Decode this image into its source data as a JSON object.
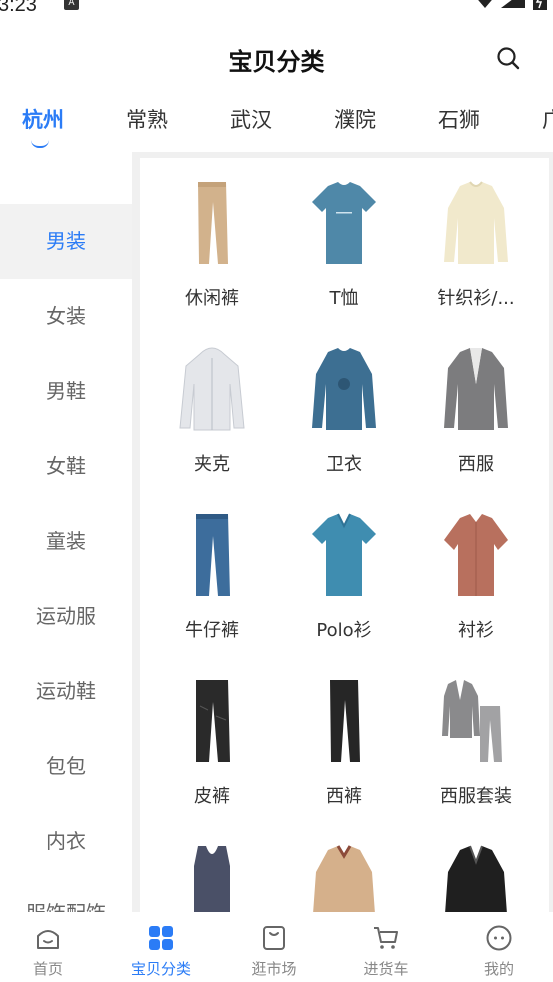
{
  "status_bar": {
    "time": "3:23",
    "notif_icon": "a-icon"
  },
  "header": {
    "title": "宝贝分类",
    "search_icon": "search-icon"
  },
  "city_tabs": [
    {
      "label": "杭州",
      "active": true
    },
    {
      "label": "常熟",
      "active": false
    },
    {
      "label": "武汉",
      "active": false
    },
    {
      "label": "濮院",
      "active": false
    },
    {
      "label": "石狮",
      "active": false
    },
    {
      "label": "广",
      "active": false
    }
  ],
  "sidebar": {
    "items": [
      {
        "label": "男装",
        "active": true
      },
      {
        "label": "女装",
        "active": false
      },
      {
        "label": "男鞋",
        "active": false
      },
      {
        "label": "女鞋",
        "active": false
      },
      {
        "label": "童装",
        "active": false
      },
      {
        "label": "运动服",
        "active": false
      },
      {
        "label": "运动鞋",
        "active": false
      },
      {
        "label": "包包",
        "active": false
      },
      {
        "label": "内衣",
        "active": false
      },
      {
        "label": "服饰配饰",
        "active": false
      }
    ]
  },
  "categories": [
    {
      "label": "休闲裤",
      "icon": "khaki-pants-image"
    },
    {
      "label": "T恤",
      "icon": "tshirt-image"
    },
    {
      "label": "针织衫/...",
      "icon": "sweater-image"
    },
    {
      "label": "夹克",
      "icon": "jacket-image"
    },
    {
      "label": "卫衣",
      "icon": "sweatshirt-image"
    },
    {
      "label": "西服",
      "icon": "blazer-image"
    },
    {
      "label": "牛仔裤",
      "icon": "jeans-image"
    },
    {
      "label": "Polo衫",
      "icon": "polo-image"
    },
    {
      "label": "衬衫",
      "icon": "shirt-image"
    },
    {
      "label": "皮裤",
      "icon": "leather-pants-image"
    },
    {
      "label": "西裤",
      "icon": "suit-pants-image"
    },
    {
      "label": "西服套装",
      "icon": "suit-set-image"
    },
    {
      "label": "",
      "icon": "vest-image"
    },
    {
      "label": "",
      "icon": "beige-coat-image"
    },
    {
      "label": "",
      "icon": "leather-jacket-image"
    }
  ],
  "bottom_nav": [
    {
      "label": "首页",
      "icon": "home-icon",
      "active": false
    },
    {
      "label": "宝贝分类",
      "icon": "grid-icon",
      "active": true
    },
    {
      "label": "逛市场",
      "icon": "bag-icon",
      "active": false
    },
    {
      "label": "进货车",
      "icon": "cart-icon",
      "active": false
    },
    {
      "label": "我的",
      "icon": "profile-icon",
      "active": false
    }
  ],
  "colors": {
    "accent": "#2b7cf6",
    "text": "#333333",
    "muted": "#888888",
    "panel_bg": "#f0f0f0"
  }
}
